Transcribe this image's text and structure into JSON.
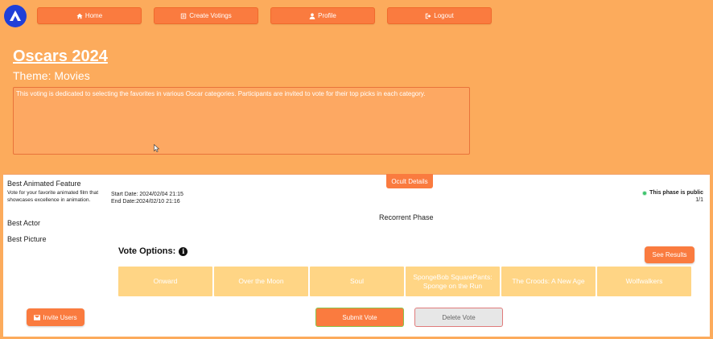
{
  "nav": {
    "home": "Home",
    "create_votings": "Create Votings",
    "profile": "Profile",
    "logout": "Logout"
  },
  "voting": {
    "title": "Oscars 2024",
    "theme": "Theme: Movies",
    "description": "This voting is dedicated to selecting the favorites in various Oscar categories. Participants are invited to vote for their top picks in each category."
  },
  "panel": {
    "ocult_details": "Ocult Details",
    "categories": [
      "Best Animated Feature",
      "Best Actor",
      "Best Picture"
    ],
    "category_description": "Vote for your favorite animated film that showcases excellence in animation.",
    "start_date": "Start Date: 2024/02/04 21:15",
    "end_date": "End Date:2024/02/10 21:16",
    "phase_visibility": "This phase is public",
    "phase_count": "1/1",
    "phase_name": "Recorrent Phase",
    "vote_options_label": "Vote Options:",
    "see_results": "See Results",
    "options": [
      "Onward",
      "Over the Moon",
      "Soul",
      "SpongeBob SquarePants: Sponge on the Run",
      "The Croods: A New Age",
      "Wolfwalkers"
    ],
    "invite_users": "Invite Users",
    "submit_vote": "Submit Vote",
    "delete_vote": "Delete Vote"
  },
  "colors": {
    "background": "#fcab5c",
    "accent": "#fa7b3f",
    "option": "#ffd585",
    "logo": "#1f3fd8",
    "public_dot": "#3ec46d"
  },
  "icons": [
    "logo-icon",
    "home-icon",
    "create-icon",
    "user-icon",
    "logout-icon",
    "info-icon",
    "mail-icon"
  ]
}
